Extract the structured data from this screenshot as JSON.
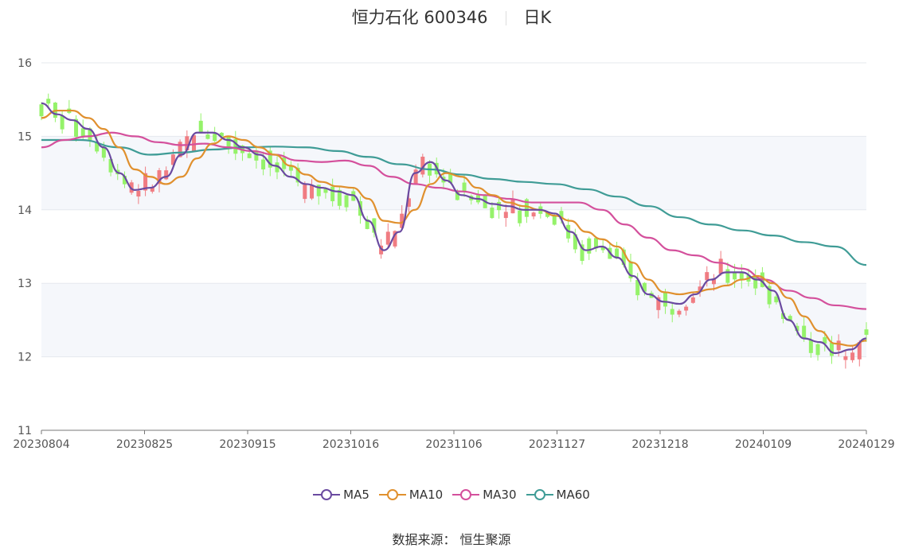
{
  "header": {
    "title": "恒力石化 600346",
    "period": "日K"
  },
  "source": {
    "label": "数据来源：",
    "value": "恒生聚源"
  },
  "colors": {
    "up": "#f07c82",
    "down": "#95f26a",
    "ma5": "#6a4aa0",
    "ma10": "#e0902e",
    "ma30": "#d4509c",
    "ma60": "#3f9c96",
    "band": "#f5f7fb",
    "grid": "#e5e8ee"
  },
  "chart_data": {
    "type": "candlestick",
    "title": "恒力石化 600346",
    "y_ticks": [
      11,
      12,
      13,
      14,
      15,
      16
    ],
    "ylim": [
      11,
      16
    ],
    "x_tick_labels": [
      "20230804",
      "20230825",
      "20230915",
      "20231016",
      "20231106",
      "20231127",
      "20231218",
      "20240109",
      "20240129"
    ],
    "legend": [
      "MA5",
      "MA10",
      "MA30",
      "MA60"
    ],
    "legend_position": "bottom",
    "n_days": 120,
    "ma": {
      "MA5": [
        [
          0,
          15.45
        ],
        [
          4,
          15.3
        ],
        [
          8,
          15.22
        ],
        [
          12,
          15.1
        ],
        [
          16,
          14.85
        ],
        [
          20,
          14.5
        ],
        [
          24,
          14.27
        ],
        [
          28,
          14.3
        ],
        [
          32,
          14.45
        ],
        [
          36,
          14.75
        ],
        [
          40,
          15.05
        ],
        [
          44,
          15.05
        ],
        [
          48,
          14.95
        ],
        [
          52,
          14.85
        ],
        [
          56,
          14.75
        ],
        [
          60,
          14.6
        ],
        [
          64,
          14.45
        ],
        [
          68,
          14.35
        ],
        [
          72,
          14.3
        ],
        [
          76,
          14.25
        ],
        [
          80,
          14.2
        ],
        [
          84,
          13.85
        ],
        [
          88,
          13.45
        ],
        [
          92,
          13.7
        ],
        [
          96,
          14.5
        ],
        [
          100,
          14.65
        ],
        [
          104,
          14.4
        ],
        [
          108,
          14.2
        ],
        [
          112,
          14.15
        ],
        [
          116,
          14.08
        ],
        [
          120,
          14.05
        ],
        [
          124,
          14.0
        ],
        [
          128,
          14.0
        ],
        [
          132,
          13.95
        ],
        [
          136,
          13.7
        ],
        [
          140,
          13.45
        ],
        [
          144,
          13.5
        ],
        [
          148,
          13.35
        ],
        [
          152,
          13.1
        ],
        [
          156,
          12.85
        ],
        [
          160,
          12.75
        ],
        [
          164,
          12.72
        ],
        [
          168,
          12.85
        ],
        [
          172,
          13.05
        ],
        [
          176,
          13.15
        ],
        [
          180,
          13.15
        ],
        [
          184,
          13.05
        ],
        [
          188,
          12.9
        ],
        [
          192,
          12.5
        ],
        [
          196,
          12.25
        ],
        [
          200,
          12.2
        ],
        [
          204,
          12.05
        ],
        [
          208,
          12.1
        ],
        [
          212,
          12.25
        ]
      ],
      "MA10": [
        [
          0,
          15.25
        ],
        [
          4,
          15.35
        ],
        [
          8,
          15.35
        ],
        [
          12,
          15.25
        ],
        [
          16,
          15.1
        ],
        [
          20,
          14.85
        ],
        [
          24,
          14.55
        ],
        [
          28,
          14.45
        ],
        [
          32,
          14.35
        ],
        [
          36,
          14.45
        ],
        [
          40,
          14.7
        ],
        [
          44,
          14.9
        ],
        [
          48,
          15.0
        ],
        [
          52,
          14.95
        ],
        [
          56,
          14.85
        ],
        [
          60,
          14.75
        ],
        [
          64,
          14.6
        ],
        [
          68,
          14.48
        ],
        [
          72,
          14.38
        ],
        [
          76,
          14.32
        ],
        [
          80,
          14.3
        ],
        [
          84,
          14.15
        ],
        [
          88,
          13.85
        ],
        [
          92,
          13.82
        ],
        [
          96,
          14.0
        ],
        [
          100,
          14.35
        ],
        [
          104,
          14.5
        ],
        [
          108,
          14.45
        ],
        [
          112,
          14.3
        ],
        [
          116,
          14.2
        ],
        [
          120,
          14.1
        ],
        [
          124,
          14.05
        ],
        [
          128,
          14.0
        ],
        [
          132,
          13.92
        ],
        [
          136,
          13.85
        ],
        [
          140,
          13.7
        ],
        [
          144,
          13.6
        ],
        [
          148,
          13.5
        ],
        [
          152,
          13.28
        ],
        [
          156,
          13.05
        ],
        [
          160,
          12.88
        ],
        [
          164,
          12.85
        ],
        [
          168,
          12.88
        ],
        [
          172,
          12.92
        ],
        [
          176,
          12.97
        ],
        [
          180,
          13.05
        ],
        [
          184,
          13.1
        ],
        [
          188,
          13.0
        ],
        [
          192,
          12.8
        ],
        [
          196,
          12.55
        ],
        [
          200,
          12.35
        ],
        [
          204,
          12.18
        ],
        [
          208,
          12.15
        ],
        [
          212,
          12.22
        ]
      ],
      "MA30": [
        [
          0,
          14.85
        ],
        [
          6,
          14.95
        ],
        [
          12,
          15.0
        ],
        [
          18,
          15.05
        ],
        [
          24,
          15.0
        ],
        [
          30,
          14.92
        ],
        [
          36,
          14.88
        ],
        [
          42,
          14.9
        ],
        [
          48,
          14.85
        ],
        [
          54,
          14.8
        ],
        [
          60,
          14.75
        ],
        [
          66,
          14.67
        ],
        [
          72,
          14.65
        ],
        [
          78,
          14.67
        ],
        [
          84,
          14.6
        ],
        [
          90,
          14.45
        ],
        [
          96,
          14.35
        ],
        [
          102,
          14.3
        ],
        [
          108,
          14.25
        ],
        [
          114,
          14.2
        ],
        [
          120,
          14.15
        ],
        [
          126,
          14.1
        ],
        [
          132,
          14.1
        ],
        [
          138,
          14.1
        ],
        [
          144,
          14.0
        ],
        [
          150,
          13.8
        ],
        [
          156,
          13.62
        ],
        [
          162,
          13.45
        ],
        [
          168,
          13.38
        ],
        [
          174,
          13.28
        ],
        [
          180,
          13.2
        ],
        [
          186,
          13.05
        ],
        [
          192,
          12.9
        ],
        [
          198,
          12.8
        ],
        [
          204,
          12.7
        ],
        [
          212,
          12.65
        ]
      ],
      "MA60": [
        [
          0,
          14.95
        ],
        [
          10,
          14.95
        ],
        [
          20,
          14.85
        ],
        [
          28,
          14.75
        ],
        [
          36,
          14.78
        ],
        [
          44,
          14.82
        ],
        [
          52,
          14.85
        ],
        [
          60,
          14.86
        ],
        [
          68,
          14.85
        ],
        [
          76,
          14.8
        ],
        [
          84,
          14.72
        ],
        [
          92,
          14.62
        ],
        [
          100,
          14.55
        ],
        [
          108,
          14.48
        ],
        [
          116,
          14.42
        ],
        [
          124,
          14.38
        ],
        [
          132,
          14.35
        ],
        [
          140,
          14.28
        ],
        [
          148,
          14.18
        ],
        [
          156,
          14.05
        ],
        [
          164,
          13.9
        ],
        [
          172,
          13.8
        ],
        [
          180,
          13.72
        ],
        [
          188,
          13.65
        ],
        [
          196,
          13.56
        ],
        [
          204,
          13.5
        ],
        [
          212,
          13.25
        ]
      ]
    }
  },
  "legend": [
    {
      "name": "MA5",
      "color": "#6a4aa0"
    },
    {
      "name": "MA10",
      "color": "#e0902e"
    },
    {
      "name": "MA30",
      "color": "#d4509c"
    },
    {
      "name": "MA60",
      "color": "#3f9c96"
    }
  ]
}
